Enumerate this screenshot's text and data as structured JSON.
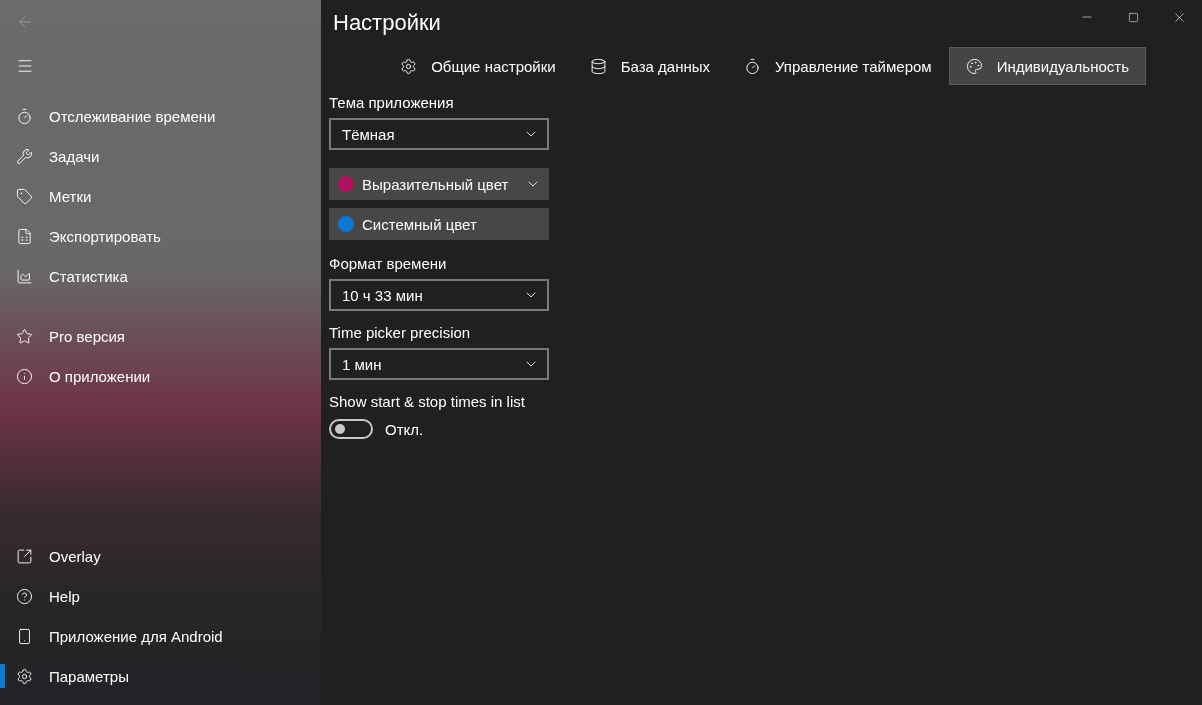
{
  "window": {
    "title": "Настройки"
  },
  "sidebar": {
    "top_items": [
      {
        "label": "Отслеживание времени",
        "selected": false
      },
      {
        "label": "Задачи",
        "selected": false
      },
      {
        "label": "Метки",
        "selected": false
      },
      {
        "label": "Экспортировать",
        "selected": false
      },
      {
        "label": "Статистика",
        "selected": false
      }
    ],
    "extra_items": [
      {
        "label": "Pro версия",
        "selected": false
      },
      {
        "label": "О приложении",
        "selected": false
      }
    ],
    "bottom_items": [
      {
        "label": "Overlay",
        "selected": false
      },
      {
        "label": "Help",
        "selected": false
      },
      {
        "label": "Приложение для Android",
        "selected": false
      },
      {
        "label": "Параметры",
        "selected": true
      }
    ]
  },
  "tabs": [
    {
      "label": "Общие настройки",
      "selected": false
    },
    {
      "label": "База данных",
      "selected": false
    },
    {
      "label": "Управление таймером",
      "selected": false
    },
    {
      "label": "Индивидуальность",
      "selected": true
    }
  ],
  "settings": [
    {
      "kind": "dropdown",
      "label": "Тема приложения",
      "value": "Тёмная"
    },
    {
      "kind": "color_button",
      "text": "Выразительный цвет",
      "color": "#b0125f",
      "dropdown": true
    },
    {
      "kind": "color_button",
      "text": "Системный цвет",
      "color": "#0a78d7",
      "dropdown": false
    },
    {
      "kind": "dropdown",
      "label": "Формат времени",
      "value": "10 ч 33 мин"
    },
    {
      "kind": "dropdown",
      "label": "Time picker precision",
      "value": "1 мин"
    },
    {
      "kind": "toggle",
      "label": "Show start & stop times in list",
      "on": false,
      "state_text": "Откл."
    }
  ]
}
